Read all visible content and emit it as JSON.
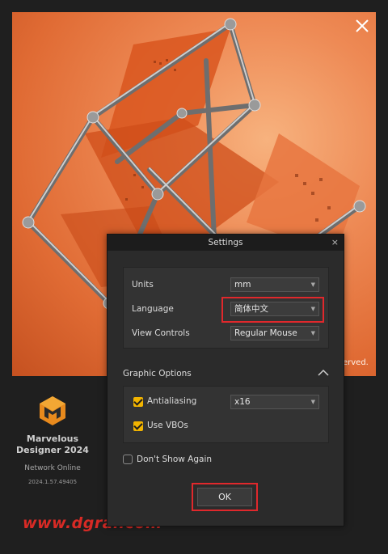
{
  "hero": {
    "overlay_text": "erved."
  },
  "brand": {
    "name_line1": "Marvelous",
    "name_line2": "Designer 2024",
    "status": "Network Online",
    "version": "2024.1.57.49405"
  },
  "watermark": "www.dgrai.com",
  "dialog": {
    "title": "Settings",
    "close_glyph": "×",
    "fields": {
      "units_label": "Units",
      "units_value": "mm",
      "language_label": "Language",
      "language_value": "简体中文",
      "view_controls_label": "View Controls",
      "view_controls_value": "Regular Mouse"
    },
    "graphic_options": {
      "section_label": "Graphic Options",
      "antialiasing_label": "Antialiasing",
      "antialiasing_checked": true,
      "antialiasing_value": "x16",
      "use_vbos_label": "Use VBOs",
      "use_vbos_checked": true
    },
    "dont_show_again_label": "Don't Show Again",
    "dont_show_again_checked": false,
    "ok_label": "OK"
  },
  "colors": {
    "accent_checkbox": "#f2b400",
    "highlight_border": "#e0282c",
    "hero_orange": "#e06b34"
  }
}
